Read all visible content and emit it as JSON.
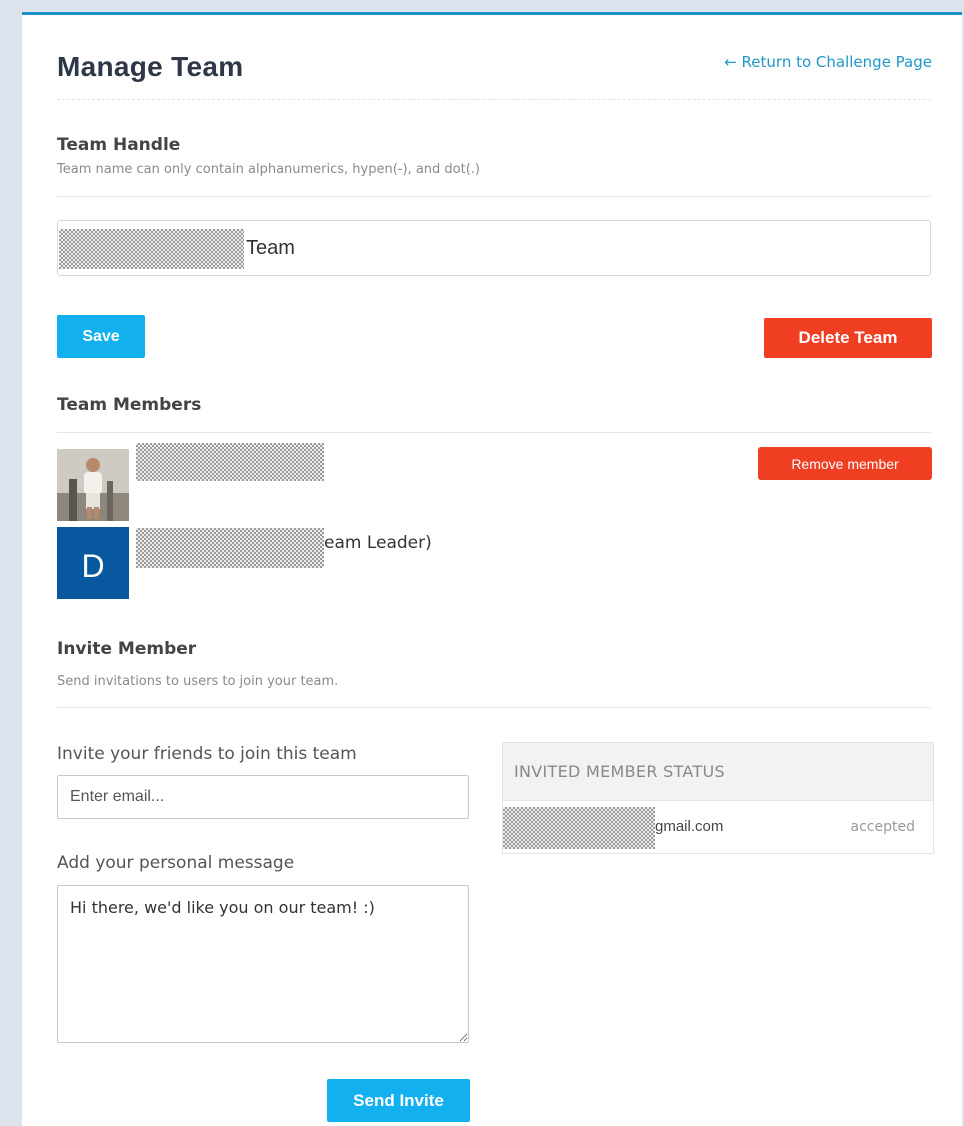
{
  "header": {
    "title": "Manage Team",
    "return_link": "← Return to Challenge Page"
  },
  "team_handle": {
    "title": "Team Handle",
    "subtitle": "Team name can only contain alphanumerics, hypen(-), and dot(.)",
    "value_visible": "Team"
  },
  "actions": {
    "save_label": "Save",
    "delete_label": "Delete Team"
  },
  "members": {
    "title": "Team Members",
    "remove_label": "Remove member",
    "items": [
      {
        "suffix": "",
        "avatar_letter": ""
      },
      {
        "suffix": "eam Leader)",
        "avatar_letter": "D"
      }
    ]
  },
  "invite": {
    "title": "Invite Member",
    "subtitle": "Send invitations to users to join your team.",
    "email_label": "Invite your friends to join this team",
    "email_placeholder": "Enter email...",
    "message_label": "Add your personal message",
    "message_value": "Hi there, we'd like you on our team! :)",
    "send_label": "Send Invite"
  },
  "invited_status": {
    "header": "INVITED MEMBER STATUS",
    "rows": [
      {
        "email_visible": "gmail.com",
        "status": "accepted"
      }
    ]
  },
  "colors": {
    "primary": "#12b0ef",
    "danger": "#ef3e22",
    "link": "#2196c9",
    "avatar_blue": "#07589e"
  }
}
